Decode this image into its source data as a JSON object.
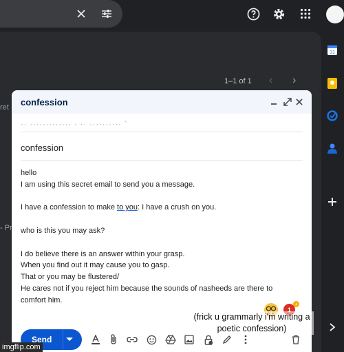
{
  "pager": {
    "range": "1–1 of 1"
  },
  "left_fragments": {
    "top": "ret",
    "mid": "- Pr"
  },
  "compose": {
    "title": "confession",
    "to_obscured": "·· ············· · ··  ·········· `",
    "subject": "confession",
    "body_lines": [
      "hello",
      "I am using this secret email to send you a message.",
      "",
      "I have a confession to make to you: I have a crush on you.",
      "",
      "who is this you may ask?",
      "",
      "I do believe there is an answer within your grasp.",
      "When you find out it may cause you to gasp.",
      "That or you may be flustered/",
      "He cares not if you reject him because the sounds of nasheeds are there to",
      "comfort him."
    ],
    "body_line4": {
      "before": "I have a confession to make ",
      "underlined": "to you",
      "after": ": I have a crush on you."
    },
    "send_label": "Send"
  },
  "overlay": {
    "caption": "(frick u grammarly i'm writing a poetic confession)",
    "badge_count": "1"
  },
  "watermark": "imgflip.com",
  "colors": {
    "send_blue": "#0b57d0",
    "header_bg": "#f2f6fc",
    "dark_bg": "#202124"
  }
}
